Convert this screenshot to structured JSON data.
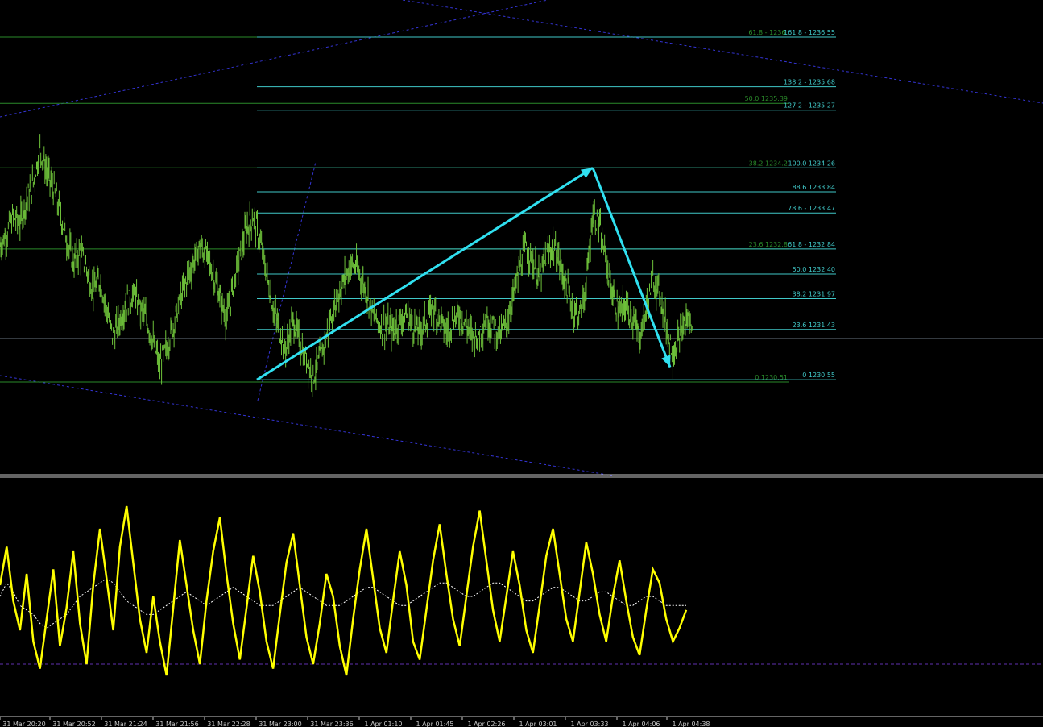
{
  "chart_data": {
    "type": "line",
    "instrument_label": "",
    "main_panel": {
      "ylim": [
        1228.9,
        1237.2
      ],
      "fib_levels": [
        {
          "label": "161.8 - 1236.55",
          "price": 1236.55
        },
        {
          "label": "138.2 - 1235.68",
          "price": 1235.68
        },
        {
          "label": "127.2 - 1235.27",
          "price": 1235.27
        },
        {
          "label": "100.0 1234.26",
          "price": 1234.26
        },
        {
          "label": "88.6 1233.84",
          "price": 1233.84
        },
        {
          "label": "78.6 - 1233.47",
          "price": 1233.47
        },
        {
          "label": "61.8 - 1232.84",
          "price": 1232.84
        },
        {
          "label": "50.0 1232.40",
          "price": 1232.4
        },
        {
          "label": "38.2 1231.97",
          "price": 1231.97
        },
        {
          "label": "23.6 1231.43",
          "price": 1231.43
        },
        {
          "label": "0 1230.55",
          "price": 1230.55
        }
      ],
      "fib_levels_secondary": [
        {
          "label": "61.8 - 1236.",
          "price": 1236.55
        },
        {
          "label": "50.0 1235.39",
          "price": 1235.39
        },
        {
          "label": "38.2 1234.2",
          "price": 1234.26
        },
        {
          "label": "23.6 1232.8",
          "price": 1232.84
        },
        {
          "label": "0 1230.51",
          "price": 1230.51
        }
      ],
      "current_price": 1231.27,
      "wave_points": [
        {
          "time": "31 Mar 23:00",
          "price": 1230.55
        },
        {
          "time": "1 Apr 03:33",
          "price": 1234.26
        },
        {
          "time": "1 Apr 04:20",
          "price": 1230.77
        }
      ],
      "price_series": [
        1232.9,
        1233.1,
        1233.4,
        1233.3,
        1233.7,
        1234.0,
        1234.6,
        1234.2,
        1233.9,
        1233.5,
        1233.0,
        1232.6,
        1232.8,
        1232.5,
        1232.1,
        1232.3,
        1231.8,
        1231.3,
        1231.6,
        1231.9,
        1232.0,
        1231.8,
        1231.6,
        1231.2,
        1230.8,
        1231.1,
        1231.5,
        1231.9,
        1232.3,
        1232.6,
        1232.9,
        1232.7,
        1232.4,
        1232.0,
        1231.6,
        1232.2,
        1232.7,
        1233.2,
        1233.4,
        1233.0,
        1232.4,
        1231.8,
        1231.4,
        1231.1,
        1231.6,
        1231.2,
        1230.9,
        1230.6,
        1230.9,
        1231.3,
        1231.8,
        1232.1,
        1232.4,
        1232.6,
        1232.4,
        1232.1,
        1231.7,
        1231.5,
        1231.5,
        1231.4,
        1231.6,
        1231.7,
        1231.5,
        1231.4,
        1231.6,
        1231.8,
        1231.6,
        1231.4,
        1231.6,
        1231.7,
        1231.5,
        1231.3,
        1231.4,
        1231.6,
        1231.5,
        1231.3,
        1231.5,
        1232.0,
        1232.5,
        1232.9,
        1232.6,
        1232.3,
        1232.7,
        1232.9,
        1232.6,
        1232.2,
        1231.8,
        1231.7,
        1232.2,
        1233.5,
        1233.2,
        1232.6,
        1232.0,
        1231.7,
        1231.9,
        1231.6,
        1231.3,
        1231.8,
        1232.3,
        1232.1,
        1231.5,
        1231.0,
        1231.3,
        1231.6
      ]
    },
    "oscillator_panel": {
      "ylim": [
        0,
        100
      ],
      "level_line": 20,
      "series": [
        {
          "name": "",
          "color": "#ffff00",
          "values": [
            55,
            72,
            48,
            35,
            60,
            30,
            18,
            40,
            62,
            28,
            45,
            70,
            38,
            20,
            55,
            80,
            58,
            35,
            72,
            90,
            65,
            40,
            25,
            50,
            30,
            15,
            45,
            75,
            55,
            35,
            20,
            48,
            70,
            85,
            60,
            38,
            22,
            45,
            68,
            52,
            30,
            18,
            42,
            65,
            78,
            55,
            32,
            20,
            38,
            60,
            50,
            28,
            15,
            40,
            62,
            80,
            58,
            36,
            25,
            48,
            70,
            55,
            30,
            22,
            44,
            66,
            82,
            60,
            40,
            28,
            50,
            72,
            88,
            66,
            44,
            30,
            50,
            70,
            55,
            35,
            25,
            46,
            68,
            80,
            60,
            40,
            30,
            52,
            74,
            60,
            42,
            30,
            50,
            66,
            48,
            32,
            24,
            44,
            62,
            56,
            40,
            30,
            36,
            44
          ]
        },
        {
          "name": "",
          "color": "#ffffff",
          "values": [
            50,
            56,
            52,
            46,
            44,
            42,
            38,
            36,
            38,
            40,
            42,
            46,
            50,
            52,
            54,
            56,
            58,
            56,
            52,
            48,
            46,
            44,
            42,
            42,
            44,
            46,
            48,
            50,
            52,
            50,
            48,
            46,
            48,
            50,
            52,
            54,
            52,
            50,
            48,
            46,
            46,
            46,
            48,
            50,
            52,
            54,
            52,
            50,
            48,
            46,
            46,
            46,
            48,
            50,
            52,
            54,
            54,
            52,
            50,
            48,
            46,
            46,
            48,
            50,
            52,
            54,
            56,
            56,
            54,
            52,
            50,
            50,
            52,
            54,
            56,
            56,
            54,
            52,
            50,
            48,
            48,
            50,
            52,
            54,
            54,
            52,
            50,
            48,
            48,
            50,
            52,
            52,
            50,
            48,
            46,
            46,
            48,
            50,
            50,
            48,
            46,
            46,
            46,
            46
          ]
        }
      ]
    },
    "x_tick_labels": [
      "31 Mar 20:20",
      "31 Mar 20:52",
      "31 Mar 21:24",
      "31 Mar 21:56",
      "31 Mar 22:28",
      "31 Mar 23:00",
      "31 Mar 23:36",
      "1 Apr 01:10",
      "1 Apr 01:45",
      "1 Apr 02:26",
      "1 Apr 03:01",
      "1 Apr 03:33",
      "1 Apr 04:06",
      "1 Apr 04:38"
    ],
    "colors": {
      "background": "#000000",
      "price_bars": "#6ec23a",
      "fib_primary": "#40c8c8",
      "fib_secondary": "#2a8a2a",
      "wave_arrows": "#30e0f0",
      "channel_lines": "#3030d0",
      "oscillator_main": "#ffff00",
      "oscillator_signal": "#ffffff",
      "oscillator_level": "#6030b0",
      "axis_text": "#c8c8c8"
    }
  }
}
